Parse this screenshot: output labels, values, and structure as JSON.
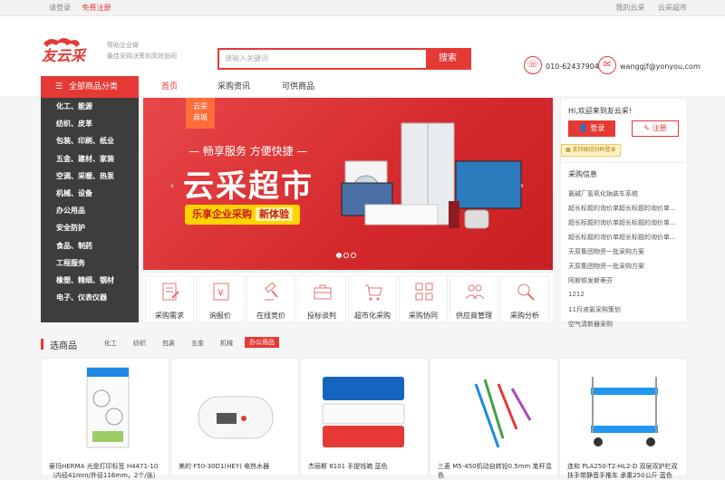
{
  "topbar": {
    "login": "请登录",
    "register": "免费注册",
    "my_cloud": "我的云采",
    "cloud_shop": "云采超市"
  },
  "header": {
    "logo_text": "友云采",
    "slogan_line1": "帮助企业做",
    "slogan_line2": "最佳采购决策和高效协同",
    "search_placeholder": "请输入关键词",
    "search_button": "搜索",
    "phone": "010-62437904",
    "email": "wanggjf@yonyou.com"
  },
  "nav": {
    "category_head": "全部商品分类",
    "items": [
      "首页",
      "采购资讯",
      "可供商品"
    ]
  },
  "sidebar": {
    "items": [
      "化工、能源",
      "纺织、皮革",
      "包装、印刷、纸业",
      "五金、建材、家装",
      "空调、采暖、热泵",
      "机械、设备",
      "办公用品",
      "安全防护",
      "食品、制药",
      "工程服务",
      "橡塑、精细、钢材",
      "电子、仪表仪器"
    ]
  },
  "banner": {
    "tag_line1": "云采",
    "tag_line2": "商城",
    "subtitle": "— 畅享服务 方便快捷 —",
    "title": "云采超市",
    "pill_text": "乐享企业采购",
    "pill_highlight": "新体验"
  },
  "services": [
    {
      "label": "采购需求",
      "icon": "document-edit-icon"
    },
    {
      "label": "询报价",
      "icon": "yen-document-icon"
    },
    {
      "label": "在线竞价",
      "icon": "gavel-icon"
    },
    {
      "label": "投标谈判",
      "icon": "briefcase-icon"
    },
    {
      "label": "超市化采购",
      "icon": "cart-icon"
    },
    {
      "label": "采购协同",
      "icon": "grid-icon"
    },
    {
      "label": "供应商管理",
      "icon": "users-icon"
    },
    {
      "label": "采购分析",
      "icon": "magnifier-icon"
    }
  ],
  "user_panel": {
    "welcome": "Hi,欢迎来到友云采!",
    "login": "登录",
    "register": "注册",
    "wechat": "支持微信扫码登录",
    "info_title": "采购信息",
    "info_items": [
      "氯碱厂氢氧化钠装车系统",
      "超长标题的询价单超长标题的询价单...",
      "超长标题的询价单超长标题的询价单...",
      "超长标题的询价单超长标题的询价单...",
      "天原集团物资一批采购方案",
      "天原集团物资一批采购方案",
      "阿斯顿发斯蒂芬",
      "1212",
      "11月液氯采购策划",
      "空气清新器采购"
    ]
  },
  "selected": {
    "title": "选商品",
    "categories": [
      "化工",
      "纺织",
      "包装",
      "五金",
      "机械",
      "办公用品"
    ],
    "active_index": 5
  },
  "products": [
    {
      "name": "豪玛HERMA 光盘打印标签 H4471-10（内径41mm/外径116mm，2个/张）"
    },
    {
      "name": "美的 F50-30D1(HEY) 电热水器"
    },
    {
      "name": "杰丽斯 8101 手提钱箱 蓝色"
    },
    {
      "name": "三菱 M5-450机动自转铅0.5mm 笔杆混色"
    },
    {
      "name": "连和 PLA250-T2-HL2-D 双层双护栏双扶手带静音手推车 承重250公斤 蓝色"
    }
  ],
  "colors": {
    "brand": "#e53935",
    "sidebar_bg": "#3d3d3d"
  }
}
